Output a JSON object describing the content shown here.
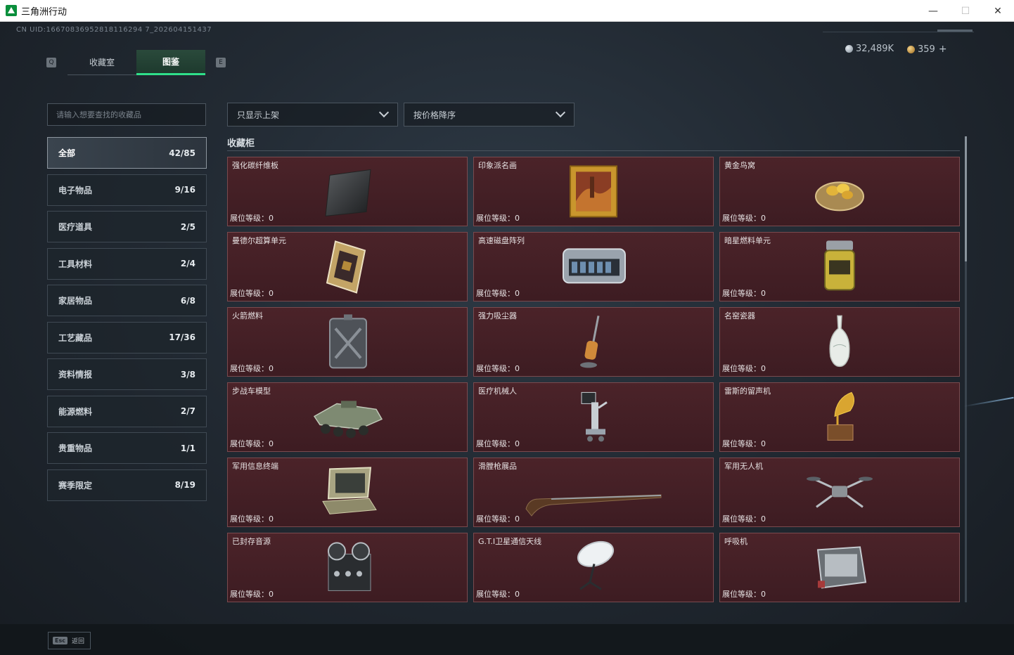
{
  "window": {
    "title": "三角洲行动",
    "minimize": "—",
    "maximize": "☐",
    "close": "✕"
  },
  "header": {
    "uid": "CN UID:16670836952818116294 7_202604151437",
    "silver": "32,489K",
    "gold": "359",
    "add": "+"
  },
  "tabs": {
    "left_key": "Q",
    "right_key": "E",
    "items": [
      {
        "label": "收藏室",
        "active": false
      },
      {
        "label": "图鉴",
        "active": true
      }
    ]
  },
  "search": {
    "placeholder": "请输入想要查找的收藏品",
    "value": ""
  },
  "categories": [
    {
      "label": "全部",
      "count": "42/85",
      "active": true
    },
    {
      "label": "电子物品",
      "count": "9/16"
    },
    {
      "label": "医疗道具",
      "count": "2/5"
    },
    {
      "label": "工具材料",
      "count": "2/4"
    },
    {
      "label": "家居物品",
      "count": "6/8"
    },
    {
      "label": "工艺藏品",
      "count": "17/36"
    },
    {
      "label": "资料情报",
      "count": "3/8"
    },
    {
      "label": "能源燃料",
      "count": "2/7"
    },
    {
      "label": "贵重物品",
      "count": "1/1"
    },
    {
      "label": "赛季限定",
      "count": "8/19"
    }
  ],
  "filters": {
    "show": "只显示上架",
    "sort": "按价格降序"
  },
  "section": {
    "title": "收藏柜"
  },
  "cards": [
    {
      "name": "强化碳纤维板",
      "level": "展位等级：0",
      "icon": "carbon-plate-icon"
    },
    {
      "name": "印象派名画",
      "level": "展位等级：0",
      "icon": "painting-icon"
    },
    {
      "name": "黄金鸟窝",
      "level": "展位等级：0",
      "icon": "golden-nest-icon"
    },
    {
      "name": "曼德尔超算单元",
      "level": "展位等级：0",
      "icon": "cpu-unit-icon"
    },
    {
      "name": "高速磁盘阵列",
      "level": "展位等级：0",
      "icon": "disk-array-icon"
    },
    {
      "name": "暗星燃料单元",
      "level": "展位等级：0",
      "icon": "fuel-cell-icon"
    },
    {
      "name": "火箭燃料",
      "level": "展位等级：0",
      "icon": "fuel-can-icon"
    },
    {
      "name": "强力吸尘器",
      "level": "展位等级：0",
      "icon": "vacuum-icon"
    },
    {
      "name": "名窑瓷器",
      "level": "展位等级：0",
      "icon": "porcelain-vase-icon"
    },
    {
      "name": "步战车模型",
      "level": "展位等级：0",
      "icon": "ifv-model-icon"
    },
    {
      "name": "医疗机械人",
      "level": "展位等级：0",
      "icon": "medical-robot-icon"
    },
    {
      "name": "雷斯的留声机",
      "level": "展位等级：0",
      "icon": "gramophone-icon"
    },
    {
      "name": "军用信息终端",
      "level": "展位等级：0",
      "icon": "military-terminal-icon"
    },
    {
      "name": "滑膛枪展品",
      "level": "展位等级：0",
      "icon": "musket-icon"
    },
    {
      "name": "军用无人机",
      "level": "展位等级：0",
      "icon": "drone-icon"
    },
    {
      "name": "已封存音源",
      "level": "展位等级：0",
      "icon": "tape-recorder-icon"
    },
    {
      "name": "G.T.I卫星通信天线",
      "level": "展位等级：0",
      "icon": "satellite-dish-icon"
    },
    {
      "name": "呼吸机",
      "level": "展位等级：0",
      "icon": "ventilator-icon"
    }
  ],
  "footer": {
    "esc_key": "Esc",
    "esc_label": "返回"
  }
}
